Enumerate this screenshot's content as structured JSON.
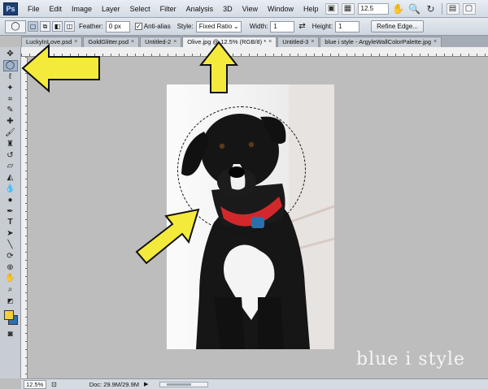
{
  "app": {
    "logo": "Ps",
    "menu": [
      "File",
      "Edit",
      "Image",
      "Layer",
      "Select",
      "Filter",
      "Analysis",
      "3D",
      "View",
      "Window",
      "Help"
    ],
    "zoom_value": "12.5"
  },
  "options": {
    "feather_label": "Feather:",
    "feather_value": "0 px",
    "antialias_label": "Anti-alias",
    "style_label": "Style:",
    "style_value": "Fixed Ratio",
    "width_label": "Width:",
    "width_value": "1",
    "height_label": "Height:",
    "height_value": "1",
    "refine_edge_label": "Refine Edge..."
  },
  "tabs": [
    {
      "label": "LuckyInLove.psd",
      "active": false
    },
    {
      "label": "GoldGlitter.psd",
      "active": false
    },
    {
      "label": "Untitled-2",
      "active": false
    },
    {
      "label": "Olive.jpg @ 12.5% (RGB/8) *",
      "active": true
    },
    {
      "label": "Untitled-3",
      "active": false
    },
    {
      "label": "blue i style - ArgyleWallColorPalette.jpg",
      "active": false
    }
  ],
  "status": {
    "zoom": "12.5%",
    "doc": "Doc: 29.9M/29.9M"
  },
  "colors": {
    "foreground": "#f2d03b",
    "background": "#2f6fb0",
    "arrow_fill": "#f4ea3c",
    "arrow_stroke": "#111111"
  },
  "watermark": "blue i style"
}
